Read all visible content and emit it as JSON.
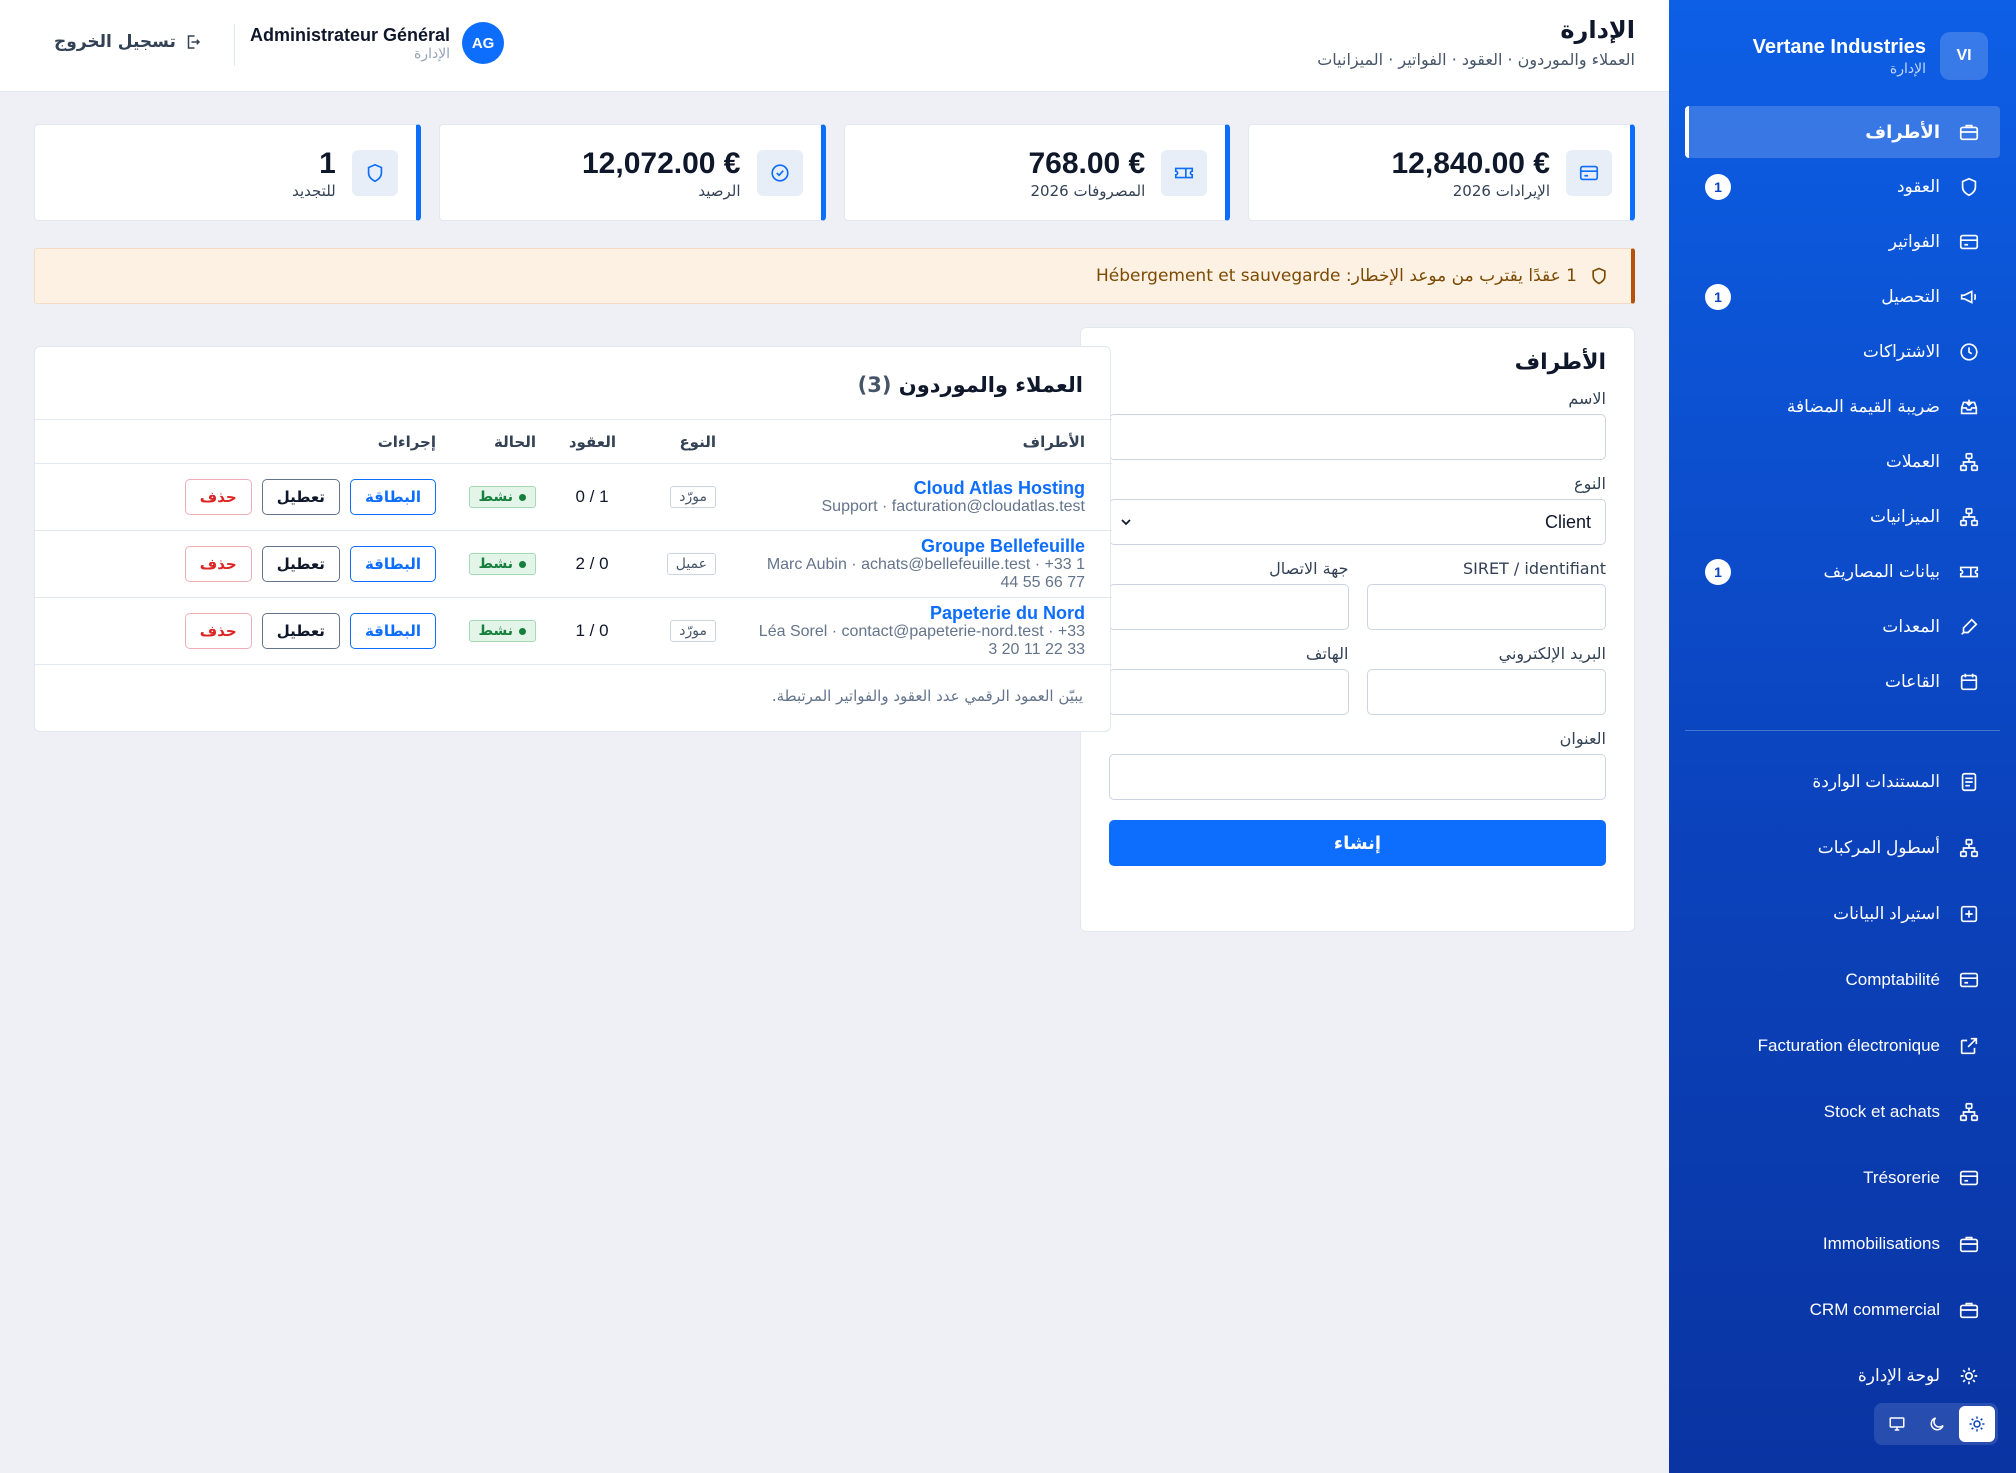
{
  "sidebar": {
    "brand_initials": "VI",
    "brand_name": "Vertane Industries",
    "brand_sub": "الإدارة",
    "items": [
      {
        "label": "الأطراف",
        "icon": "briefcase-icon",
        "active": true
      },
      {
        "label": "العقود",
        "icon": "shield-icon",
        "badge": "1"
      },
      {
        "label": "الفواتير",
        "icon": "card-icon"
      },
      {
        "label": "التحصيل",
        "icon": "megaphone-icon",
        "badge": "1"
      },
      {
        "label": "الاشتراكات",
        "icon": "clock-icon"
      },
      {
        "label": "ضريبة القيمة المضافة",
        "icon": "inbox-icon"
      },
      {
        "label": "العملات",
        "icon": "network-icon"
      },
      {
        "label": "الميزانيات",
        "icon": "network-icon"
      },
      {
        "label": "بيانات المصاريف",
        "icon": "ticket-icon",
        "badge": "1"
      },
      {
        "label": "المعدات",
        "icon": "pen-icon"
      },
      {
        "label": "القاعات",
        "icon": "calendar-icon"
      }
    ],
    "items2": [
      {
        "label": "المستندات الواردة",
        "icon": "document-icon"
      },
      {
        "label": "أسطول المركبات",
        "icon": "network-icon"
      },
      {
        "label": "استيراد البيانات",
        "icon": "plus-square-icon"
      },
      {
        "label": "Comptabilité",
        "icon": "card-icon"
      },
      {
        "label": "Facturation électronique",
        "icon": "external-link-icon"
      },
      {
        "label": "Stock et achats",
        "icon": "network-icon"
      },
      {
        "label": "Trésorerie",
        "icon": "card-icon"
      },
      {
        "label": "Immobilisations",
        "icon": "briefcase-icon"
      },
      {
        "label": "CRM commercial",
        "icon": "briefcase-icon"
      },
      {
        "label": "لوحة الإدارة",
        "icon": "gear-icon"
      }
    ]
  },
  "header": {
    "title": "الإدارة",
    "crumb": "العملاء والموردون · العقود · الفواتير · الميزانيات",
    "user_initials": "AG",
    "user_name": "Administrateur Général",
    "user_role": "الإدارة",
    "logout": "تسجيل الخروج"
  },
  "stats": [
    {
      "value": "€ 12,840.00",
      "label": "الإيرادات 2026",
      "icon": "card-icon"
    },
    {
      "value": "€ 768.00",
      "label": "المصروفات 2026",
      "icon": "ticket-icon"
    },
    {
      "value": "€ 12,072.00",
      "label": "الرصيد",
      "icon": "check-circle-icon"
    },
    {
      "value": "1",
      "label": "للتجديد",
      "icon": "shield-icon"
    }
  ],
  "alert": {
    "text": "1 عقدًا يقترب من موعد الإخطار: Hébergement et sauvegarde"
  },
  "form": {
    "title": "الأطراف",
    "name_label": "الاسم",
    "type_label": "النوع",
    "type_value": "Client",
    "siret_label": "SIRET / identifiant",
    "contact_label": "جهة الاتصال",
    "email_label": "البريد الإلكتروني",
    "phone_label": "الهاتف",
    "address_label": "العنوان",
    "submit": "إنشاء"
  },
  "table": {
    "title": "العملاء والموردون",
    "count": "(3)",
    "headers": {
      "party": "الأطراف",
      "type": "النوع",
      "contracts": "العقود",
      "status": "الحالة",
      "actions": "إجراءات"
    },
    "rows": [
      {
        "name": "Cloud Atlas Hosting",
        "meta": "Support · facturation@cloudatlas.test",
        "type": "مورّد",
        "contracts": "0 / 1",
        "status": "نشط"
      },
      {
        "name": "Groupe Bellefeuille",
        "meta": "Marc Aubin · achats@bellefeuille.test · +33 1 44 55 66 77",
        "type": "عميل",
        "contracts": "2 / 0",
        "status": "نشط"
      },
      {
        "name": "Papeterie du Nord",
        "meta": "Léa Sorel · contact@papeterie-nord.test · +33 3 20 11 22 33",
        "type": "مورّد",
        "contracts": "1 / 0",
        "status": "نشط"
      }
    ],
    "btn_card": "البطاقة",
    "btn_disable": "تعطيل",
    "btn_delete": "حذف",
    "note": "يبيّن العمود الرقمي عدد العقود والفواتير المرتبطة."
  },
  "colors": {
    "accent": "#0d6efd",
    "sidebar_top": "#0d5fe6",
    "sidebar_bottom": "#0a34a2",
    "alert_border": "#b45309",
    "status_green": "#15803d",
    "danger": "#dc2626"
  }
}
